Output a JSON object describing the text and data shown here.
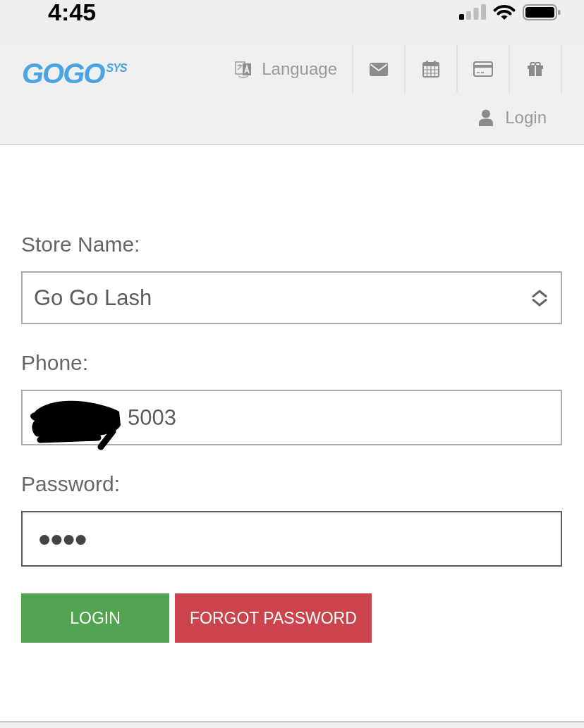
{
  "status_bar": {
    "time": "4:45"
  },
  "header": {
    "logo": "GOGO$^{SYS}$",
    "language": "Language",
    "login": "Login"
  },
  "form": {
    "fields": [
      {
        "kind": "select",
        "label": "Store Name:",
        "value": "Go Go Lash",
        "focused": false
      },
      {
        "kind": "phone",
        "label": "Phone:",
        "value": "5003",
        "focused": false,
        "redacted": true
      },
      {
        "kind": "password",
        "label": "Password:",
        "value": "••••",
        "focused": true
      }
    ],
    "buttons": [
      {
        "kind": "success",
        "label": "LOGIN"
      },
      {
        "kind": "danger",
        "label": "FORGOT PASSWORD"
      }
    ]
  }
}
